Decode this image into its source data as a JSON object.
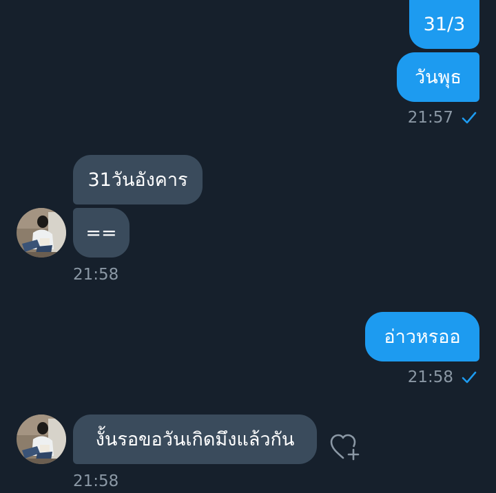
{
  "messages": [
    {
      "direction": "outgoing",
      "text": "31/3"
    },
    {
      "direction": "outgoing",
      "text": "วันพุธ",
      "time": "21:57",
      "status_icon": "sent-check-icon"
    },
    {
      "direction": "incoming",
      "text": "31วันอังคาร"
    },
    {
      "direction": "incoming",
      "text": "==",
      "time": "21:58"
    },
    {
      "direction": "outgoing",
      "text": "อ่าวหรออ",
      "time": "21:58",
      "status_icon": "sent-check-icon"
    },
    {
      "direction": "incoming",
      "text": "งั้นรอขอวันเกิดมึงแล้วกัน",
      "time": "21:58",
      "reaction_icon": "add-reaction-heart-icon"
    }
  ],
  "colors": {
    "background": "#16202c",
    "outgoing_bubble": "#1d9bf0",
    "incoming_bubble": "#3a4b5c",
    "timestamp": "#8b98a5",
    "check": "#1d9bf0"
  }
}
